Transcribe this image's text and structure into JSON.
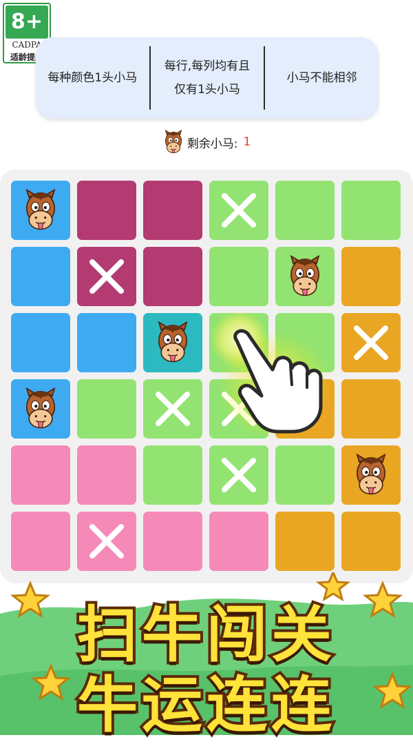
{
  "badge": {
    "age": "8+",
    "org": "CADPA",
    "tip": "适龄提示"
  },
  "rules": [
    {
      "text": "每种颜色1头小马"
    },
    {
      "text": "每行,每列均有且仅有1头小马"
    },
    {
      "text": "小马不能相邻"
    }
  ],
  "status": {
    "label": "剩余小马:",
    "count": "1"
  },
  "board": {
    "rows": 6,
    "cols": 6,
    "cells": [
      [
        "blue",
        "horse",
        "magenta",
        "empty",
        "magenta",
        "empty",
        "green",
        "cross",
        "green",
        "empty",
        "green",
        "empty"
      ],
      [
        "blue",
        "empty",
        "magenta",
        "cross",
        "magenta",
        "empty",
        "green",
        "empty",
        "green",
        "horse",
        "orange",
        "empty"
      ],
      [
        "blue",
        "empty",
        "blue",
        "empty",
        "teal",
        "horse",
        "green",
        "empty",
        "green",
        "empty",
        "orange",
        "cross"
      ],
      [
        "blue",
        "horse",
        "green",
        "empty",
        "green",
        "cross",
        "green",
        "cross",
        "orange",
        "empty",
        "orange",
        "empty"
      ],
      [
        "pink",
        "empty",
        "pink",
        "empty",
        "green",
        "empty",
        "green",
        "cross",
        "green",
        "empty",
        "orange",
        "horse"
      ],
      [
        "pink",
        "empty",
        "pink",
        "cross",
        "pink",
        "empty",
        "pink",
        "empty",
        "orange",
        "empty",
        "orange",
        "empty"
      ]
    ]
  },
  "colors": {
    "blue": "#3eaaf2",
    "magenta": "#b33b72",
    "teal": "#2cbac0",
    "green": "#93e373",
    "orange": "#e9a623",
    "pink": "#f58ab8"
  },
  "banner": {
    "line1": "扫牛闯关",
    "line2": "牛运连连"
  },
  "icons": {
    "horse": "horse-face-icon",
    "cross": "cross-mark-icon",
    "hand": "pointing-hand-icon",
    "star": "star-icon"
  }
}
